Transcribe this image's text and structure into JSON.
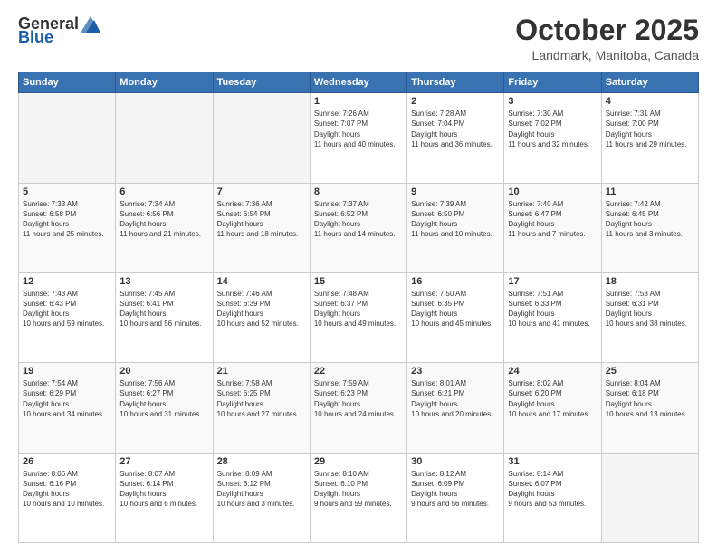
{
  "header": {
    "logo_general": "General",
    "logo_blue": "Blue",
    "month_title": "October 2025",
    "location": "Landmark, Manitoba, Canada"
  },
  "weekdays": [
    "Sunday",
    "Monday",
    "Tuesday",
    "Wednesday",
    "Thursday",
    "Friday",
    "Saturday"
  ],
  "weeks": [
    [
      {
        "day": "",
        "empty": true
      },
      {
        "day": "",
        "empty": true
      },
      {
        "day": "",
        "empty": true
      },
      {
        "day": "1",
        "sunrise": "7:26 AM",
        "sunset": "7:07 PM",
        "daylight": "11 hours and 40 minutes."
      },
      {
        "day": "2",
        "sunrise": "7:28 AM",
        "sunset": "7:04 PM",
        "daylight": "11 hours and 36 minutes."
      },
      {
        "day": "3",
        "sunrise": "7:30 AM",
        "sunset": "7:02 PM",
        "daylight": "11 hours and 32 minutes."
      },
      {
        "day": "4",
        "sunrise": "7:31 AM",
        "sunset": "7:00 PM",
        "daylight": "11 hours and 29 minutes."
      }
    ],
    [
      {
        "day": "5",
        "sunrise": "7:33 AM",
        "sunset": "6:58 PM",
        "daylight": "11 hours and 25 minutes."
      },
      {
        "day": "6",
        "sunrise": "7:34 AM",
        "sunset": "6:56 PM",
        "daylight": "11 hours and 21 minutes."
      },
      {
        "day": "7",
        "sunrise": "7:36 AM",
        "sunset": "6:54 PM",
        "daylight": "11 hours and 18 minutes."
      },
      {
        "day": "8",
        "sunrise": "7:37 AM",
        "sunset": "6:52 PM",
        "daylight": "11 hours and 14 minutes."
      },
      {
        "day": "9",
        "sunrise": "7:39 AM",
        "sunset": "6:50 PM",
        "daylight": "11 hours and 10 minutes."
      },
      {
        "day": "10",
        "sunrise": "7:40 AM",
        "sunset": "6:47 PM",
        "daylight": "11 hours and 7 minutes."
      },
      {
        "day": "11",
        "sunrise": "7:42 AM",
        "sunset": "6:45 PM",
        "daylight": "11 hours and 3 minutes."
      }
    ],
    [
      {
        "day": "12",
        "sunrise": "7:43 AM",
        "sunset": "6:43 PM",
        "daylight": "10 hours and 59 minutes."
      },
      {
        "day": "13",
        "sunrise": "7:45 AM",
        "sunset": "6:41 PM",
        "daylight": "10 hours and 56 minutes."
      },
      {
        "day": "14",
        "sunrise": "7:46 AM",
        "sunset": "6:39 PM",
        "daylight": "10 hours and 52 minutes."
      },
      {
        "day": "15",
        "sunrise": "7:48 AM",
        "sunset": "6:37 PM",
        "daylight": "10 hours and 49 minutes."
      },
      {
        "day": "16",
        "sunrise": "7:50 AM",
        "sunset": "6:35 PM",
        "daylight": "10 hours and 45 minutes."
      },
      {
        "day": "17",
        "sunrise": "7:51 AM",
        "sunset": "6:33 PM",
        "daylight": "10 hours and 41 minutes."
      },
      {
        "day": "18",
        "sunrise": "7:53 AM",
        "sunset": "6:31 PM",
        "daylight": "10 hours and 38 minutes."
      }
    ],
    [
      {
        "day": "19",
        "sunrise": "7:54 AM",
        "sunset": "6:29 PM",
        "daylight": "10 hours and 34 minutes."
      },
      {
        "day": "20",
        "sunrise": "7:56 AM",
        "sunset": "6:27 PM",
        "daylight": "10 hours and 31 minutes."
      },
      {
        "day": "21",
        "sunrise": "7:58 AM",
        "sunset": "6:25 PM",
        "daylight": "10 hours and 27 minutes."
      },
      {
        "day": "22",
        "sunrise": "7:59 AM",
        "sunset": "6:23 PM",
        "daylight": "10 hours and 24 minutes."
      },
      {
        "day": "23",
        "sunrise": "8:01 AM",
        "sunset": "6:21 PM",
        "daylight": "10 hours and 20 minutes."
      },
      {
        "day": "24",
        "sunrise": "8:02 AM",
        "sunset": "6:20 PM",
        "daylight": "10 hours and 17 minutes."
      },
      {
        "day": "25",
        "sunrise": "8:04 AM",
        "sunset": "6:18 PM",
        "daylight": "10 hours and 13 minutes."
      }
    ],
    [
      {
        "day": "26",
        "sunrise": "8:06 AM",
        "sunset": "6:16 PM",
        "daylight": "10 hours and 10 minutes."
      },
      {
        "day": "27",
        "sunrise": "8:07 AM",
        "sunset": "6:14 PM",
        "daylight": "10 hours and 6 minutes."
      },
      {
        "day": "28",
        "sunrise": "8:09 AM",
        "sunset": "6:12 PM",
        "daylight": "10 hours and 3 minutes."
      },
      {
        "day": "29",
        "sunrise": "8:10 AM",
        "sunset": "6:10 PM",
        "daylight": "9 hours and 59 minutes."
      },
      {
        "day": "30",
        "sunrise": "8:12 AM",
        "sunset": "6:09 PM",
        "daylight": "9 hours and 56 minutes."
      },
      {
        "day": "31",
        "sunrise": "8:14 AM",
        "sunset": "6:07 PM",
        "daylight": "9 hours and 53 minutes."
      },
      {
        "day": "",
        "empty": true
      }
    ]
  ],
  "labels": {
    "sunrise": "Sunrise:",
    "sunset": "Sunset:",
    "daylight": "Daylight:"
  }
}
